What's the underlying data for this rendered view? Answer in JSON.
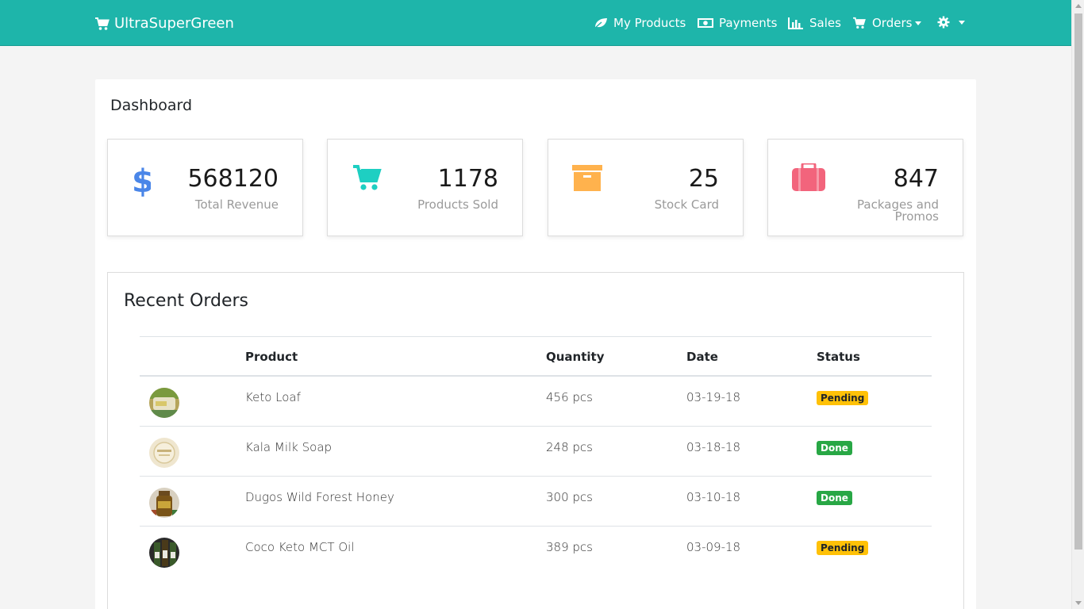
{
  "brand": {
    "name": "UltraSuperGreen",
    "icon": "cart-icon"
  },
  "nav": [
    {
      "label": "My Products",
      "icon": "leaf-icon"
    },
    {
      "label": "Payments",
      "icon": "money-icon"
    },
    {
      "label": "Sales",
      "icon": "bar-chart-icon"
    },
    {
      "label": "Orders",
      "icon": "cart-icon"
    }
  ],
  "settings": {
    "icon": "gear-icon"
  },
  "page": {
    "title": "Dashboard"
  },
  "stats": [
    {
      "value": "568120",
      "label": "Total Revenue",
      "icon": "dollar-icon",
      "color": "#4a86e8"
    },
    {
      "value": "1178",
      "label": "Products Sold",
      "icon": "cart-icon",
      "color": "#1ecfc2"
    },
    {
      "value": "25",
      "label": "Stock Card",
      "icon": "archive-icon",
      "color": "#ffb24d"
    },
    {
      "value": "847",
      "label": "Packages and Promos",
      "icon": "briefcase-icon",
      "color": "#f2647c"
    }
  ],
  "orders": {
    "title": "Recent Orders",
    "columns": [
      "Product",
      "Quantity",
      "Date",
      "Status"
    ],
    "rows": [
      {
        "product": "Keto Loaf",
        "quantity": "456 pcs",
        "date": "03-19-18",
        "status": "Pending"
      },
      {
        "product": "Kala Milk Soap",
        "quantity": "248 pcs",
        "date": "03-18-18",
        "status": "Done"
      },
      {
        "product": "Dugos Wild Forest Honey",
        "quantity": "300 pcs",
        "date": "03-10-18",
        "status": "Done"
      },
      {
        "product": "Coco Keto MCT Oil",
        "quantity": "389 pcs",
        "date": "03-09-18",
        "status": "Pending"
      }
    ]
  },
  "colors": {
    "navbar": "#1eb5aa",
    "pending": "#ffc107",
    "done": "#28a745"
  }
}
